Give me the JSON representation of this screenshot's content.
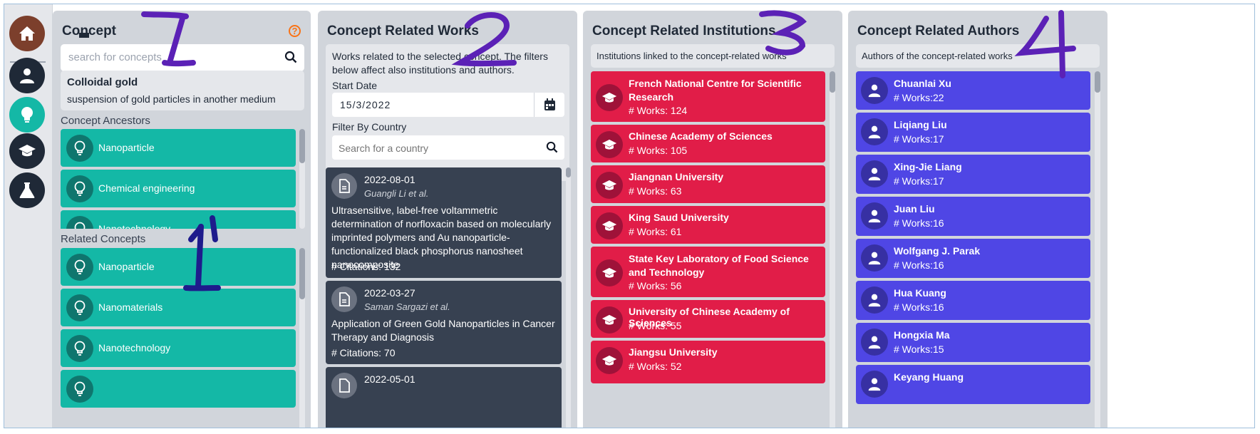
{
  "nav": {
    "items": [
      {
        "icon": "home-icon",
        "active": true
      },
      {
        "icon": "user-icon"
      },
      {
        "icon": "lightbulb-icon"
      },
      {
        "icon": "graduation-cap-icon"
      },
      {
        "icon": "flask-icon"
      }
    ]
  },
  "concept_panel": {
    "title": "Concept",
    "search_placeholder": "search for concepts",
    "selected": {
      "name": "Colloidal gold",
      "description": "suspension of gold particles in another medium"
    },
    "ancestors_label": "Concept Ancestors",
    "ancestors": [
      "Nanoparticle",
      "Chemical engineering",
      "Nanotechnology"
    ],
    "related_label": "Related Concepts",
    "related": [
      "Nanoparticle",
      "Nanomaterials",
      "Nanotechnology",
      ""
    ]
  },
  "works_panel": {
    "title": "Concept Related Works",
    "description": "Works related to the selected concept. The filters below affect also institutions and authors.",
    "start_date_label": "Start Date",
    "start_date_value": "15/3/2022",
    "country_label": "Filter By Country",
    "country_placeholder": "Search for a country",
    "works": [
      {
        "date": "2022-08-01",
        "authors": "Guangli Li et al.",
        "title": "Ultrasensitive, label-free voltammetric determination of norfloxacin based on molecularly imprinted polymers and Au nanoparticle-functionalized black phosphorus nanosheet nanocomposite",
        "citations": "# Citations: 132"
      },
      {
        "date": "2022-03-27",
        "authors": "Saman Sargazi et al.",
        "title": "Application of Green Gold Nanoparticles in Cancer Therapy and Diagnosis",
        "citations": "# Citations: 70"
      },
      {
        "date": "2022-05-01",
        "authors": "",
        "title": "",
        "citations": ""
      }
    ]
  },
  "institutions_panel": {
    "title": "Concept Related Institutions",
    "description": "Institutions linked to the concept-related works",
    "items": [
      {
        "name": "French National Centre for Scientific Research",
        "works": "# Works: 124"
      },
      {
        "name": "Chinese Academy of Sciences",
        "works": "# Works: 105"
      },
      {
        "name": "Jiangnan University",
        "works": "# Works: 63"
      },
      {
        "name": "King Saud University",
        "works": "# Works: 61"
      },
      {
        "name": "State Key Laboratory of Food Science and Technology",
        "works": "# Works: 56"
      },
      {
        "name": "University of Chinese Academy of Sciences",
        "works": "# Works: 55"
      },
      {
        "name": "Jiangsu University",
        "works": "# Works: 52"
      }
    ]
  },
  "authors_panel": {
    "title": "Concept Related Authors",
    "description": "Authors of the concept-related works",
    "items": [
      {
        "name": "Chuanlai Xu",
        "works": "# Works:22"
      },
      {
        "name": "Liqiang Liu",
        "works": "# Works:17"
      },
      {
        "name": "Xing-Jie Liang",
        "works": "# Works:17"
      },
      {
        "name": "Juan Liu",
        "works": "# Works:16"
      },
      {
        "name": "Wolfgang J. Parak",
        "works": "# Works:16"
      },
      {
        "name": "Hua Kuang",
        "works": "# Works:16"
      },
      {
        "name": "Hongxia Ma",
        "works": "# Works:15"
      },
      {
        "name": "Keyang Huang",
        "works": ""
      }
    ]
  },
  "annotations": [
    "1",
    "2",
    "3",
    "4",
    "1"
  ],
  "colors": {
    "teal": "#14b8a6",
    "dark": "#374151",
    "red": "#e11d48",
    "indigo": "#4f46e5",
    "annotation": "#5b21b6"
  }
}
